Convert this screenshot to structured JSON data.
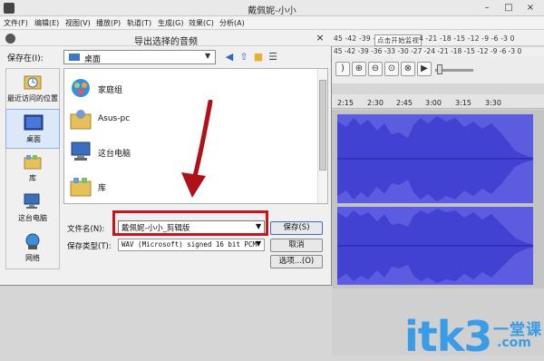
{
  "app": {
    "title": "戴佩妮-小小",
    "menu": [
      "文件(F)",
      "编辑(E)",
      "视图(V)",
      "播放(P)",
      "轨道(T)",
      "生成(G)",
      "效果(C)",
      "分析(A)"
    ],
    "meter_left": "45 -42 -39 -3",
    "meter_hint": "点击开始监视",
    "meter_right": "4 -21 -18 -15 -12 -9 -6 -3 0",
    "meter_bottom": "45 -42 -39 -36 -33 -30 -27 -24 -21 -18 -15 -12 -9 -6 -3 0",
    "ruler_ticks": [
      "2:15",
      "2:30",
      "2:45",
      "3:00",
      "3:15",
      "3:30"
    ],
    "tool_buttons": [
      "zoom-in-icon",
      "zoom-out-icon",
      "fit-selection-icon",
      "fit-project-icon",
      "play-icon"
    ]
  },
  "dialog": {
    "title": "导出选择的音频",
    "close": "×",
    "save_in_label": "保存在(I):",
    "save_in_value": "桌面",
    "places": [
      {
        "label": "最近访问的位置",
        "icon": "recent-places-icon"
      },
      {
        "label": "桌面",
        "icon": "desktop-icon"
      },
      {
        "label": "库",
        "icon": "library-icon"
      },
      {
        "label": "这台电脑",
        "icon": "computer-icon"
      },
      {
        "label": "网络",
        "icon": "network-icon"
      }
    ],
    "files": [
      {
        "label": "家庭组",
        "icon": "homegroup-icon"
      },
      {
        "label": "Asus-pc",
        "icon": "user-folder-icon"
      },
      {
        "label": "这台电脑",
        "icon": "computer-icon"
      },
      {
        "label": "库",
        "icon": "library-icon"
      }
    ],
    "filename_label": "文件名(N):",
    "filename_value": "戴佩妮-小小_剪辑版",
    "filetype_label": "保存类型(T):",
    "filetype_value": "WAV (Microsoft) signed 16 bit PCM",
    "save_button": "保存(S)",
    "cancel_button": "取消",
    "options_button": "选项...(O)"
  },
  "watermark": {
    "main": "itk3",
    "cn": "一堂课",
    "sub": ".com"
  },
  "colors": {
    "waveform": "#5c5ce0",
    "highlight": "#c8141c",
    "watermark": "#3a9be6"
  }
}
